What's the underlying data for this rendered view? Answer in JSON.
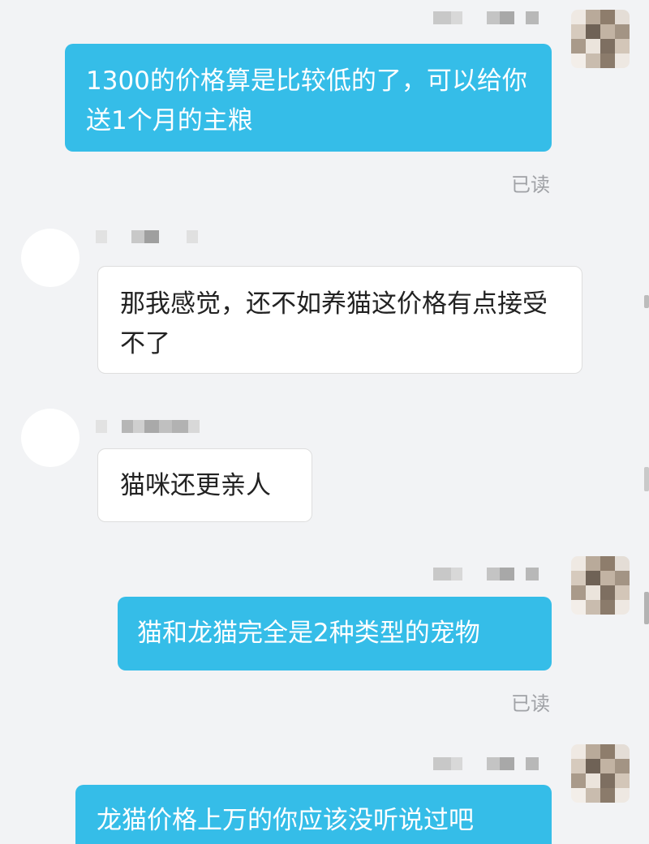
{
  "messages": [
    {
      "text": "1300的价格算是比较低的了，可以给你送1个月的主粮",
      "read": "已读"
    },
    {
      "text": "那我感觉，还不如养猫这价格有点接受不了"
    },
    {
      "text": "猫咪还更亲人"
    },
    {
      "text": "猫和龙猫完全是2种类型的宠物",
      "read": "已读"
    },
    {
      "text": "龙猫价格上万的你应该没听说过吧"
    }
  ],
  "theme": {
    "outgoing_bubble": "#35bde8",
    "incoming_bubble": "#ffffff",
    "background": "#f2f3f5",
    "read_receipt": "#a0a2a6"
  },
  "icons": {
    "self_avatar": "pixelated-avatar-icon",
    "contact_avatar": "blank-avatar-icon"
  }
}
